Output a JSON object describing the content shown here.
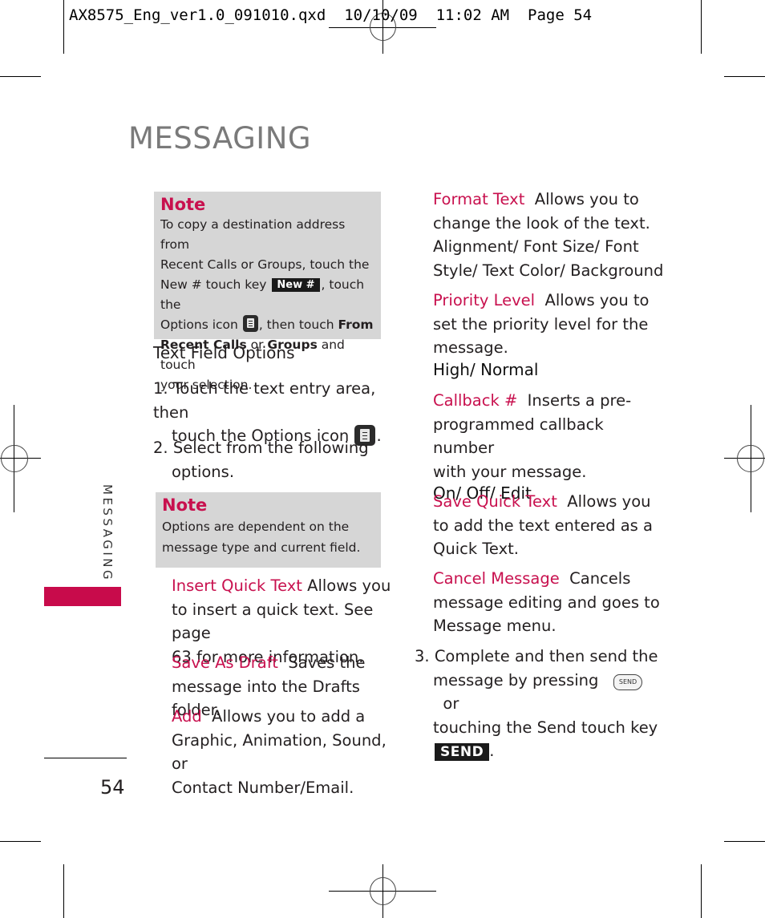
{
  "slug": {
    "filename": "AX8575_Eng_ver1.0_091010.qxd",
    "date": "10/10/09",
    "time": "11:02 AM",
    "page_label": "Page 54"
  },
  "page_title": "MESSAGING",
  "side_tab": {
    "label": "MESSAGING",
    "accent_color": "#c80b4b"
  },
  "page_number": "54",
  "note1": {
    "title": "Note",
    "line1": "To copy a destination address from",
    "line2": "Recent Calls or Groups, touch the",
    "line3a": "New # touch key",
    "key_label": "New #",
    "line3b": ", touch the",
    "line4a": "Options icon",
    "line4b": ", then touch",
    "bold_from": "From",
    "bold_recent": "Recent Calls",
    "or": "or",
    "bold_groups": "Groups",
    "line5b": "and touch",
    "line6": "your selection."
  },
  "section_heading": "Text Field Options",
  "steps": [
    {
      "num": "1.",
      "line1": "Touch the text entry area, then",
      "line2": "touch the Options icon",
      "end": "."
    },
    {
      "num": "2.",
      "line1": "Select from the following",
      "line2": "options."
    },
    {
      "num": "3.",
      "line1": "Complete and then send the",
      "line2a": "message by pressing",
      "hw_key": "SEND",
      "line2b": "or",
      "line3": "touching the Send touch key",
      "touch_key": "SEND",
      "end": "."
    }
  ],
  "note2": {
    "title": "Note",
    "line1": "Options are dependent on the",
    "line2": "message type and current field."
  },
  "options": [
    {
      "term": "Insert Quick Text",
      "l1": " Allows you",
      "l2": "to insert a quick text. See page",
      "l3": "63 for more information."
    },
    {
      "term": "Save As Draft",
      "l1": "  Saves the",
      "l2": "message into the Drafts folder."
    },
    {
      "term": "Add",
      "l1": "  Allows you to add a",
      "l2": "Graphic, Animation, Sound, or",
      "l3": "Contact Number/Email."
    },
    {
      "term": "Format Text",
      "l1": "  Allows you to",
      "l2": "change the look of the text.",
      "l3": "Alignment/ Font Size/ Font",
      "l4": "Style/ Text Color/ Background"
    },
    {
      "term": "Priority Level",
      "l1": "  Allows you to",
      "l2": "set the priority level for the",
      "l3": "message.",
      "values": "High/ Normal"
    },
    {
      "term": "Callback #",
      "l1": "  Inserts a pre-",
      "l2": "programmed callback number",
      "l3": "with your message.",
      "values": "On/ Off/ Edit"
    },
    {
      "term": "Save Quick Text",
      "l1": "  Allows you",
      "l2": "to add the text entered as a",
      "l3": "Quick Text."
    },
    {
      "term": "Cancel Message",
      "l1": "  Cancels",
      "l2": "message editing and goes to",
      "l3": "Message menu."
    }
  ]
}
